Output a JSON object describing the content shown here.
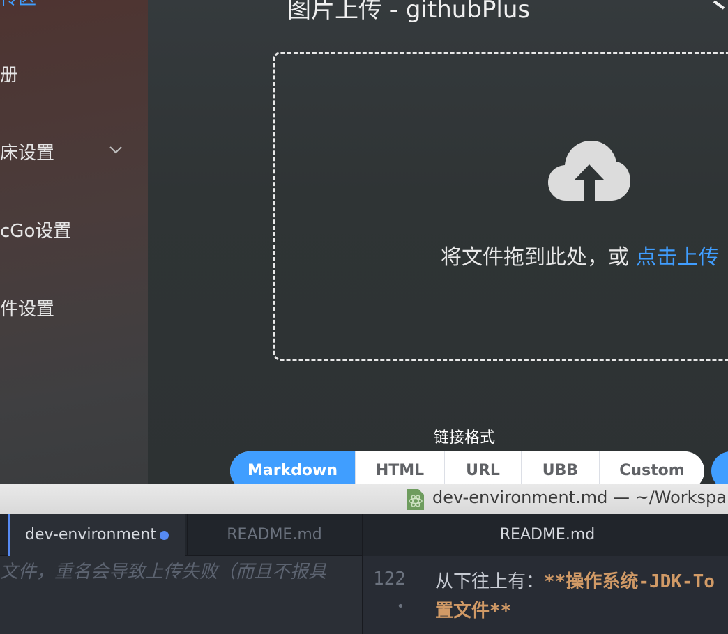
{
  "picgo": {
    "sidebar": {
      "items": [
        {
          "label": "传区",
          "active": true
        },
        {
          "label": "册"
        },
        {
          "label": "床设置",
          "has_submenu": true
        },
        {
          "label": "cGo设置"
        },
        {
          "label": "件设置"
        }
      ]
    },
    "page_title": "图片上传 - githubPlus",
    "dropzone": {
      "text": "将文件拖到此处，或",
      "link": "点击上传"
    },
    "link_format": {
      "label": "链接格式",
      "options": [
        "Markdown",
        "HTML",
        "URL",
        "UBB",
        "Custom"
      ],
      "selected": "Markdown"
    },
    "colors": {
      "accent": "#409eff"
    }
  },
  "atom": {
    "window_title": "dev-environment.md — ~/Workspa",
    "left_pane": {
      "tabs": [
        {
          "label": "dev-environment",
          "active": true,
          "modified": true
        },
        {
          "label": "README.md"
        }
      ],
      "line": "文件，重名会导致上传失败（而且不报具"
    },
    "right_pane": {
      "tab": "README.md",
      "lines": [
        {
          "number": "122",
          "text": "从下往上有：",
          "bold": "**操作系统-JDK-To"
        },
        {
          "number": "•",
          "text": "",
          "bold": "置文件**"
        }
      ]
    }
  }
}
